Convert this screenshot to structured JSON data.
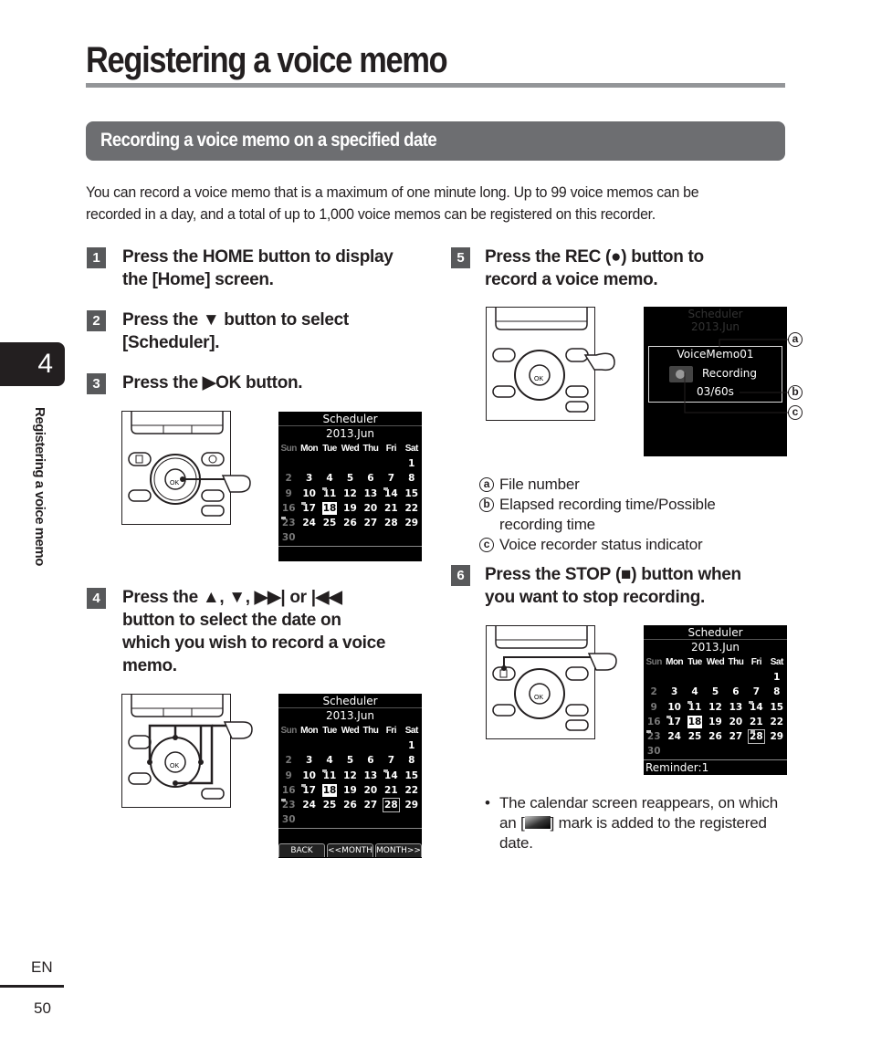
{
  "page": {
    "title": "Registering a voice memo",
    "section_title": "Recording a voice memo on a specified date",
    "intro": "You can record a voice memo that is a maximum of one minute long. Up to 99 voice memos can be recorded in a day, and a total of up to 1,000 voice memos can be registered on this recorder.",
    "chapter_number": "4",
    "side_label": "Registering a voice memo",
    "language": "EN",
    "page_number": "50"
  },
  "steps": [
    {
      "num": "1",
      "parts": [
        "Press the ",
        "HOME",
        " button to display",
        "the [",
        "Home",
        "] screen."
      ]
    },
    {
      "num": "2",
      "parts": [
        "Press the ▼ button to select",
        "[",
        "Scheduler",
        "]."
      ]
    },
    {
      "num": "3",
      "parts": [
        "Press the ▶",
        "OK",
        " button."
      ]
    },
    {
      "num": "4",
      "lines": [
        "Press the ▲, ▼, ▶▶| or |◀◀",
        "button to select the date on",
        "which you wish to record a voice",
        "memo."
      ]
    },
    {
      "num": "5",
      "parts": [
        "Press the ",
        "REC",
        " (●) button to",
        "record a voice memo."
      ]
    },
    {
      "num": "6",
      "parts": [
        "Press the ",
        "STOP",
        " (■) button when",
        "you want to stop recording."
      ]
    }
  ],
  "calendar": {
    "title": "Scheduler",
    "month": "2013.Jun",
    "weekdays": [
      "Sun",
      "Mon",
      "Tue",
      "Wed",
      "Thu",
      "Fri",
      "Sat"
    ],
    "days": [
      "",
      "",
      "",
      "",
      "",
      "",
      "1",
      "2",
      "3",
      "4",
      "5",
      "6",
      "7",
      "8",
      "9",
      "10",
      "11",
      "12",
      "13",
      "14",
      "15",
      "16",
      "17",
      "18",
      "19",
      "20",
      "21",
      "22",
      "23",
      "24",
      "25",
      "26",
      "27",
      "28",
      "29",
      "30"
    ],
    "marked_days": [
      "11",
      "14",
      "17",
      "23"
    ],
    "selected_day": "18",
    "softkeys": [
      "BACK",
      "<<MONTH",
      "MONTH>>"
    ],
    "reminder": "Reminder:1"
  },
  "recording_screen": {
    "file_name": "VoiceMemo01",
    "status": "Recording",
    "time": "03/60s"
  },
  "callouts": {
    "a": {
      "letter": "a",
      "label": "File number"
    },
    "b": {
      "letter": "b",
      "label": "Elapsed recording time/Possible",
      "label2": "recording time"
    },
    "c": {
      "letter": "c",
      "label": "Voice recorder status indicator"
    }
  },
  "note": {
    "bullet": "•",
    "before": "The calendar screen reappears, on which an [",
    "after": "] mark is added to the registered date."
  }
}
